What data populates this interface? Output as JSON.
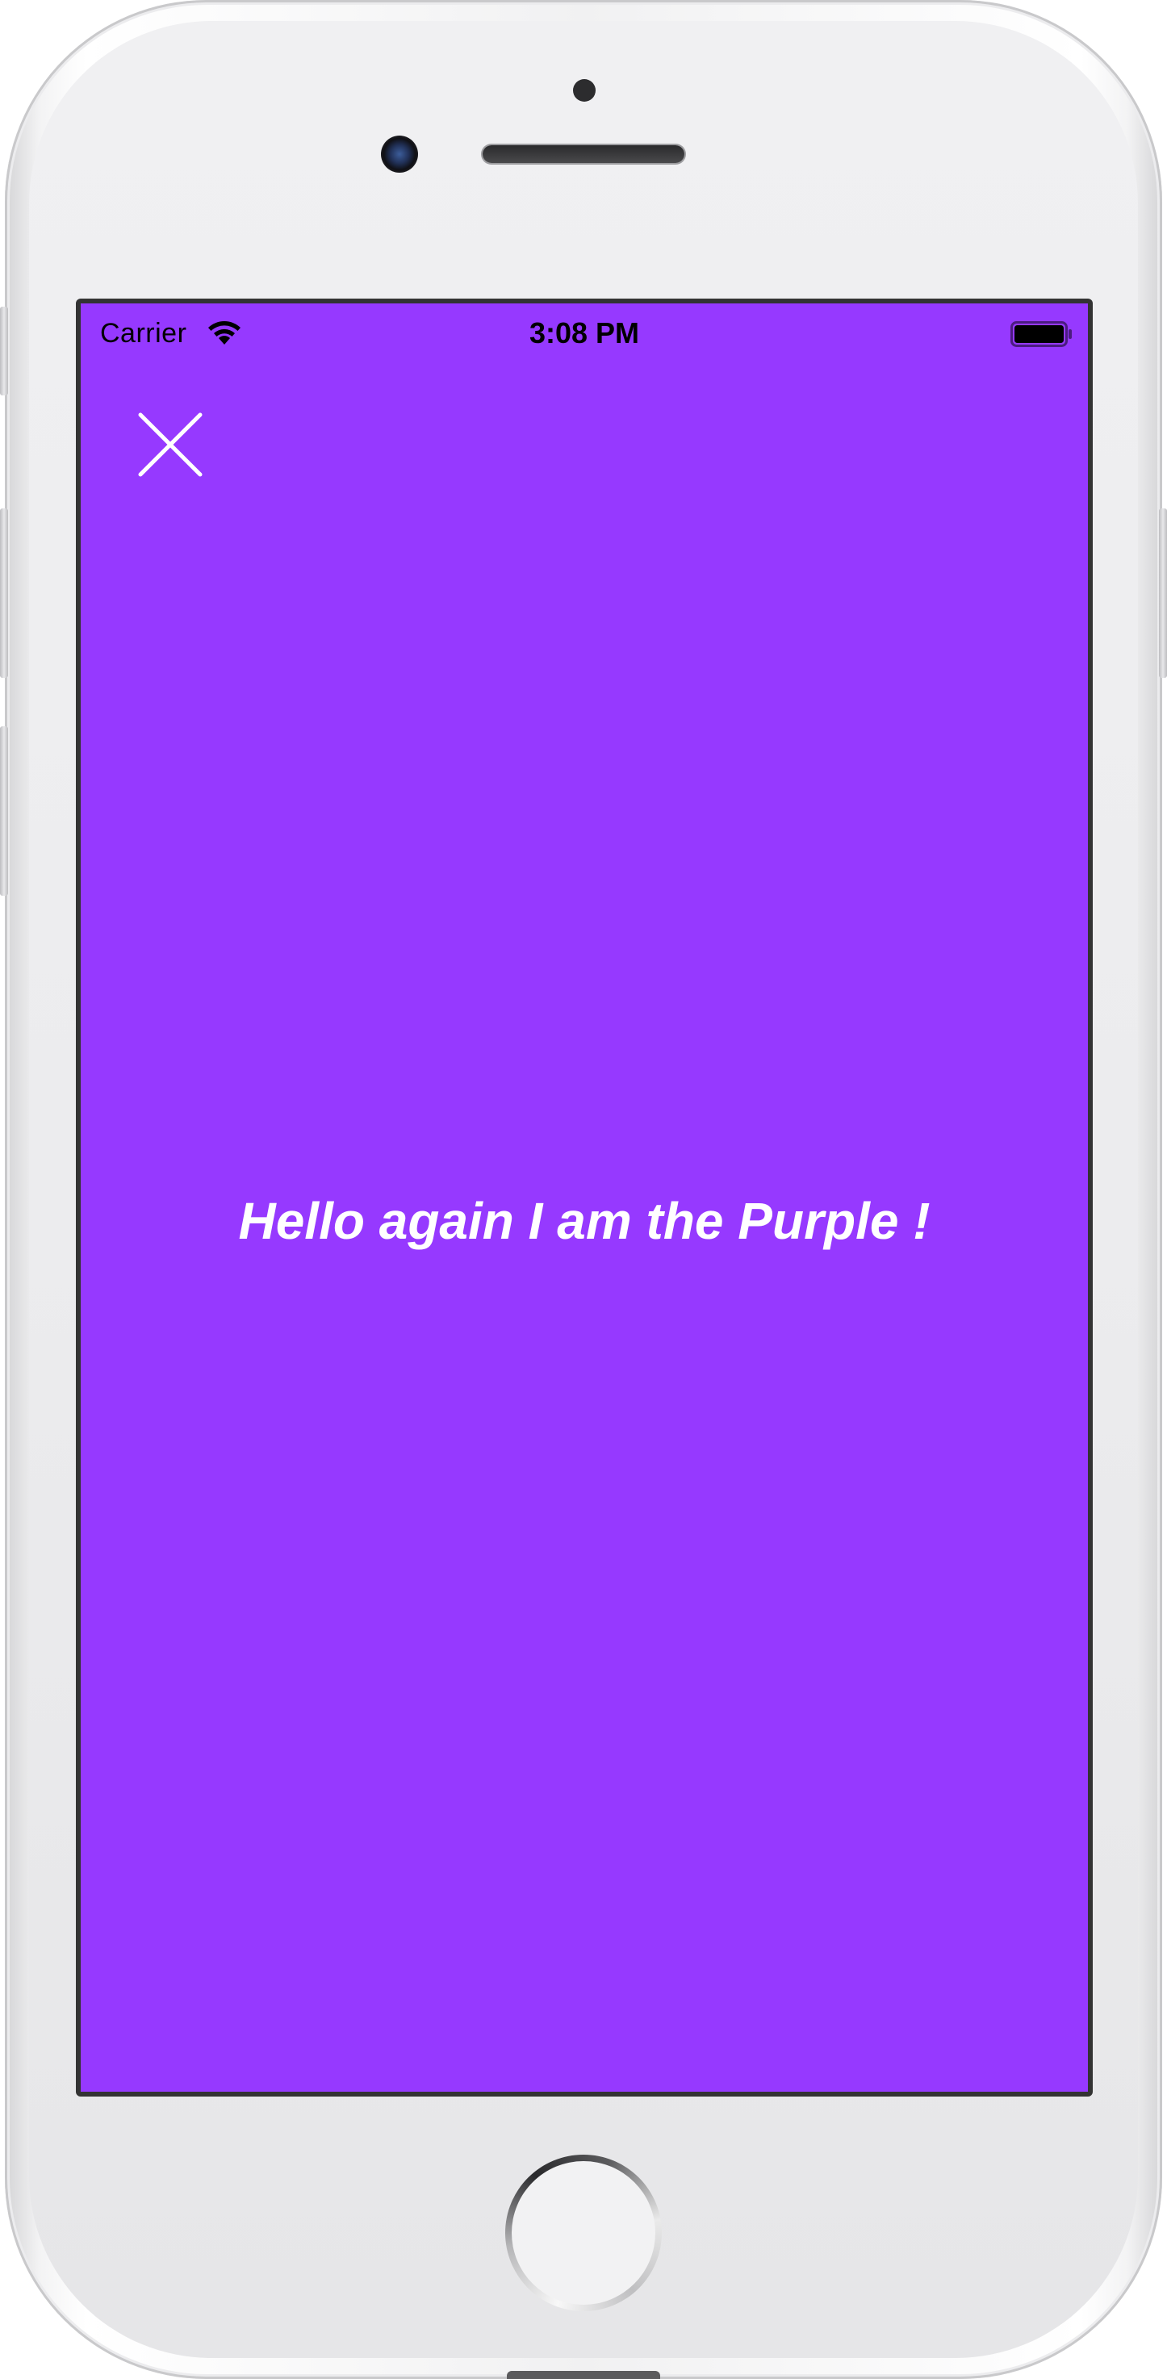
{
  "status_bar": {
    "carrier": "Carrier",
    "time": "3:08 PM"
  },
  "screen": {
    "background_color": "#9639ff",
    "message": "Hello again I am the Purple !"
  },
  "icons": {
    "close": "close-icon",
    "wifi": "wifi-icon",
    "battery": "battery-icon"
  }
}
